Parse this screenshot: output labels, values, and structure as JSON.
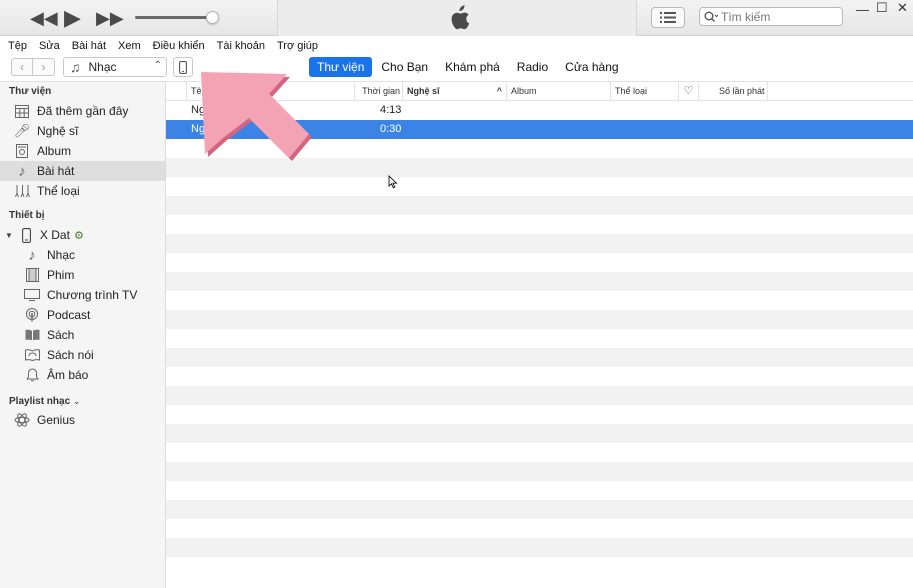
{
  "transport": {
    "prev_icon": "rewind-icon",
    "play_icon": "play-icon",
    "next_icon": "fast-forward-icon"
  },
  "search": {
    "placeholder": "Tìm kiếm"
  },
  "menu": [
    "Tệp",
    "Sửa",
    "Bài hát",
    "Xem",
    "Điều khiển",
    "Tài khoản",
    "Trợ giúp"
  ],
  "nav": {
    "back": "‹",
    "forward": "›",
    "media_type": "Nhạc",
    "tabs": [
      "Thư viện",
      "Cho Bạn",
      "Khám phá",
      "Radio",
      "Cửa hàng"
    ],
    "active_tab": "Thư viện"
  },
  "sidebar": {
    "library_header": "Thư viện",
    "library": [
      {
        "label": "Đã thêm gần đây",
        "icon": "grid-calendar-icon"
      },
      {
        "label": "Nghệ sĩ",
        "icon": "microphone-icon"
      },
      {
        "label": "Album",
        "icon": "album-icon"
      },
      {
        "label": "Bài hát",
        "icon": "music-note-icon",
        "selected": true
      },
      {
        "label": "Thể loại",
        "icon": "genres-icon"
      }
    ],
    "devices_header": "Thiết bị",
    "device_name": "X Dat",
    "device_items": [
      {
        "label": "Nhạc",
        "icon": "music-note-icon"
      },
      {
        "label": "Phim",
        "icon": "film-icon"
      },
      {
        "label": "Chương trình TV",
        "icon": "tv-icon"
      },
      {
        "label": "Podcast",
        "icon": "podcast-icon"
      },
      {
        "label": "Sách",
        "icon": "book-icon"
      },
      {
        "label": "Sách nói",
        "icon": "audiobook-icon"
      },
      {
        "label": "Âm báo",
        "icon": "bell-icon"
      }
    ],
    "playlists_header": "Playlist nhạc",
    "playlists": [
      {
        "label": "Genius",
        "icon": "genius-atom-icon"
      }
    ]
  },
  "table": {
    "columns": {
      "name": "Tê",
      "time": "Thời gian",
      "artist": "Nghệ sĩ",
      "album": "Album",
      "genre": "Thể loại",
      "love": "♡",
      "plays": "Số lần phát"
    },
    "rows": [
      {
        "name": "Ng",
        "time": "4:13",
        "selected": false
      },
      {
        "name": "Ngo",
        "time": "0:30",
        "selected": true
      }
    ]
  },
  "colors": {
    "accent": "#1a73e8",
    "selection": "#3b84e6",
    "annotation": "#f08fa3"
  }
}
